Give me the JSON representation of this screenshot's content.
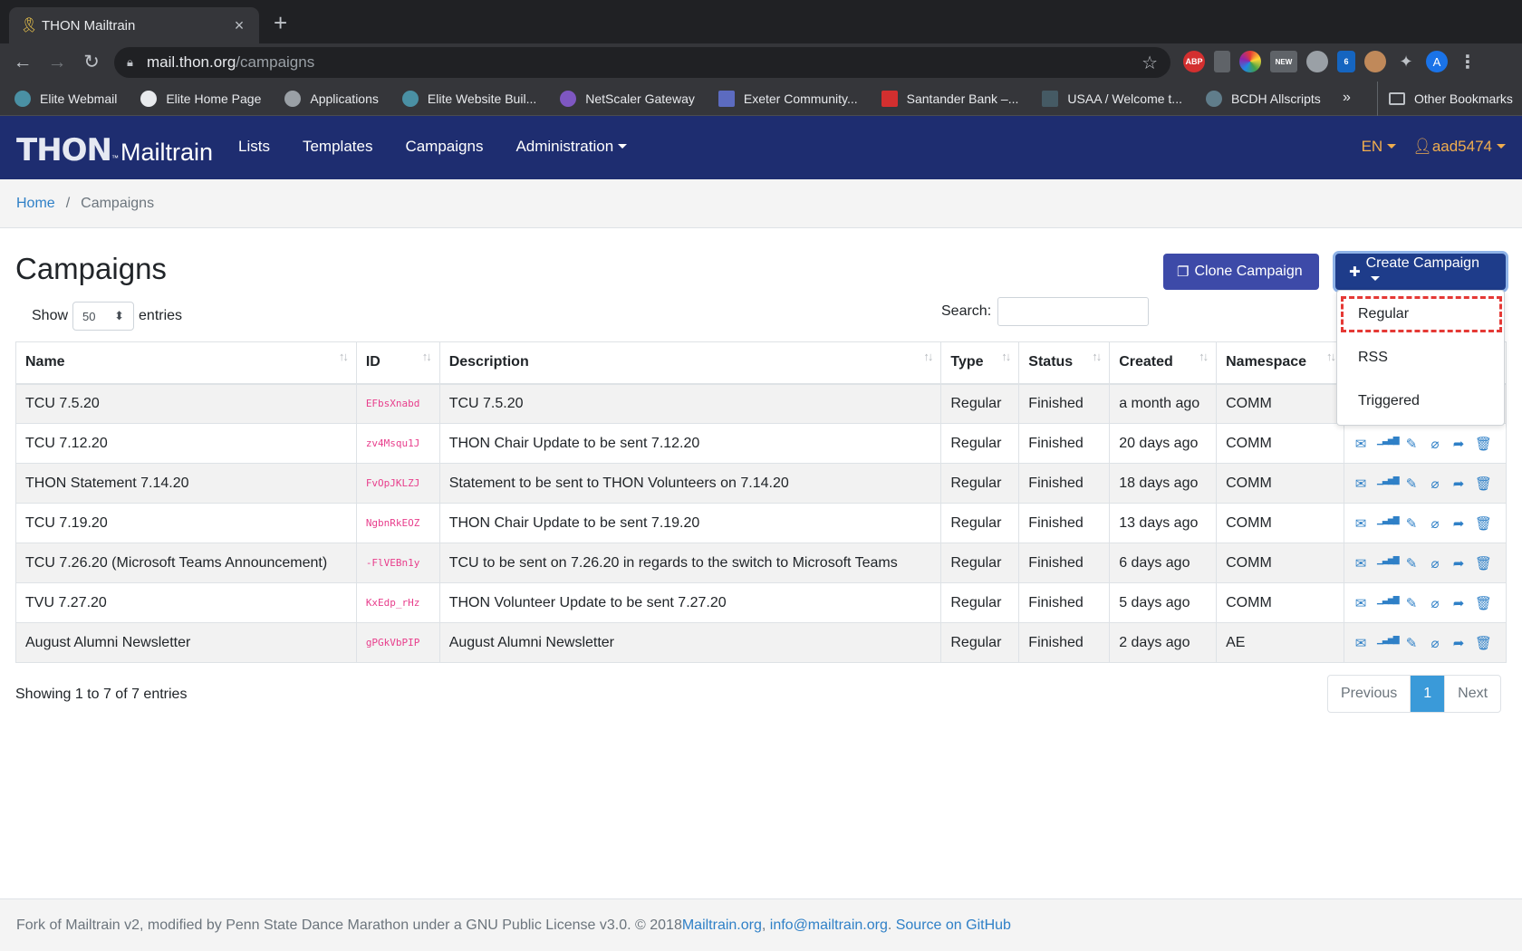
{
  "browser": {
    "tab_title": "THON Mailtrain",
    "url_host": "mail.thon.org",
    "url_path": "/campaigns",
    "extensions": [
      "ABP",
      "",
      "",
      "NEW",
      "",
      "6",
      "",
      "",
      "A",
      "⋮"
    ],
    "bookmarks": [
      {
        "label": "Elite Webmail",
        "color": "#4a90a4"
      },
      {
        "label": "Elite Home Page",
        "color": "#e8eaed"
      },
      {
        "label": "Applications",
        "color": "#9aa0a6"
      },
      {
        "label": "Elite Website Buil...",
        "color": "#4a90a4"
      },
      {
        "label": "NetScaler Gateway",
        "color": "#7e57c2"
      },
      {
        "label": "Exeter Community...",
        "color": "#5c6bc0"
      },
      {
        "label": "Santander Bank –...",
        "color": "#d32f2f"
      },
      {
        "label": "USAA / Welcome t...",
        "color": "#455a64"
      },
      {
        "label": "BCDH Allscripts",
        "color": "#607d8b"
      }
    ],
    "bookmarks_more": "»",
    "other_bookmarks": "Other Bookmarks"
  },
  "nav": {
    "brand_main": "THON",
    "brand_tm": "™",
    "brand_sub": "Mailtrain",
    "links": [
      "Lists",
      "Templates",
      "Campaigns",
      "Administration"
    ],
    "language": "EN",
    "user": "aad5474"
  },
  "breadcrumb": {
    "home": "Home",
    "separator": "/",
    "current": "Campaigns"
  },
  "page": {
    "title": "Campaigns",
    "clone_button": "Clone Campaign",
    "create_button": "Create Campaign",
    "show_label": "Show",
    "page_length": "50",
    "entries_label": "entries",
    "search_label": "Search:",
    "search_value": ""
  },
  "dropdown": {
    "items": [
      "Regular",
      "RSS",
      "Triggered"
    ]
  },
  "table": {
    "headers": [
      "Name",
      "ID",
      "Description",
      "Type",
      "Status",
      "Created",
      "Namespace"
    ],
    "rows": [
      {
        "name": "TCU 7.5.20",
        "id": "EFbsXnabd",
        "description": "TCU 7.5.20",
        "type": "Regular",
        "status": "Finished",
        "created": "a month ago",
        "namespace": "COMM"
      },
      {
        "name": "TCU 7.12.20",
        "id": "zv4Msqu1J",
        "description": "THON Chair Update to be sent 7.12.20",
        "type": "Regular",
        "status": "Finished",
        "created": "20 days ago",
        "namespace": "COMM"
      },
      {
        "name": "THON Statement 7.14.20",
        "id": "FvOpJKLZJ",
        "description": "Statement to be sent to THON Volunteers on 7.14.20",
        "type": "Regular",
        "status": "Finished",
        "created": "18 days ago",
        "namespace": "COMM"
      },
      {
        "name": "TCU 7.19.20",
        "id": "NgbnRkEOZ",
        "description": "THON Chair Update to be sent 7.19.20",
        "type": "Regular",
        "status": "Finished",
        "created": "13 days ago",
        "namespace": "COMM"
      },
      {
        "name": "TCU 7.26.20 (Microsoft Teams Announcement)",
        "id": "-FlVEBn1y",
        "description": "TCU to be sent on 7.26.20 in regards to the switch to Microsoft Teams",
        "type": "Regular",
        "status": "Finished",
        "created": "6 days ago",
        "namespace": "COMM"
      },
      {
        "name": "TVU 7.27.20",
        "id": "KxEdp_rHz",
        "description": "THON Volunteer Update to be sent 7.27.20",
        "type": "Regular",
        "status": "Finished",
        "created": "5 days ago",
        "namespace": "COMM"
      },
      {
        "name": "August Alumni Newsletter",
        "id": "gPGkVbPIP",
        "description": "August Alumni Newsletter",
        "type": "Regular",
        "status": "Finished",
        "created": "2 days ago",
        "namespace": "AE"
      }
    ],
    "row_action_icons": [
      "envelope-icon",
      "bar-chart-icon",
      "edit-icon",
      "paperclip-icon",
      "share-icon",
      "trash-icon"
    ]
  },
  "summary": "Showing 1 to 7 of 7 entries",
  "pagination": {
    "previous": "Previous",
    "current": "1",
    "next": "Next"
  },
  "footer": {
    "text": "Fork of Mailtrain v2, modified by Penn State Dance Marathon under a GNU Public License v3.0. © 2018 ",
    "link1": "Mailtrain.org",
    "comma": ", ",
    "link2": "info@mailtrain.org",
    "dot": ". ",
    "link3": "Source on GitHub"
  },
  "colors": {
    "navbar": "#1e2d70",
    "accent": "#3d4aa8",
    "link": "#2f80c7",
    "highlight": "#e53935"
  }
}
